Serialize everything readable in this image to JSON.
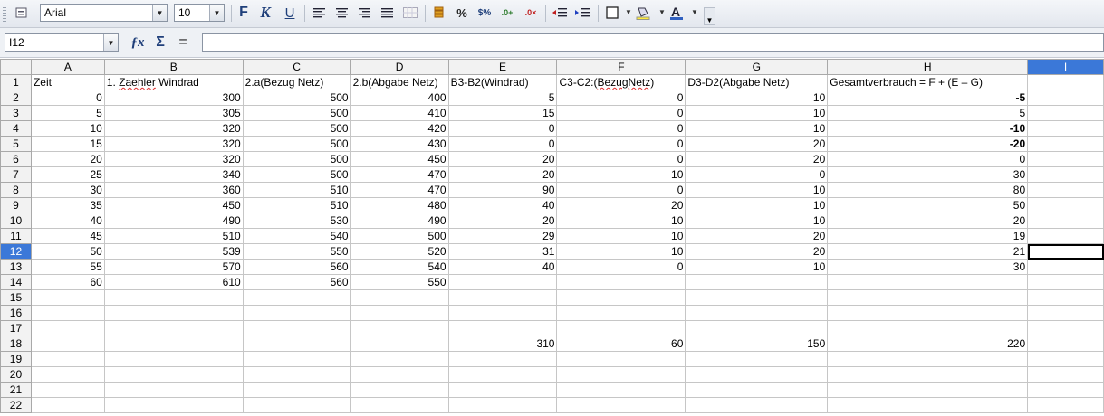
{
  "toolbar": {
    "font_name": "Arial",
    "font_size": "10",
    "bold_label": "F",
    "italic_label": "K",
    "underline_label": "U",
    "percent_label": "%"
  },
  "formula_bar": {
    "cell_ref": "I12",
    "formula": ""
  },
  "sheet": {
    "columns": [
      "A",
      "B",
      "C",
      "D",
      "E",
      "F",
      "G",
      "H",
      "I"
    ],
    "selected_column": "I",
    "selected_row": "12",
    "rows": [
      {
        "n": "1",
        "cells": [
          "Zeit",
          "1. Zaehler Windrad",
          "2.a(Bezug Netz)",
          "2.b(Abgabe Netz)",
          "B3-B2(Windrad)",
          "C3-C2:(BezugNetz)",
          "D3-D2(Abgabe Netz)",
          "Gesamtverbrauch = F + (E – G)",
          ""
        ]
      },
      {
        "n": "2",
        "cells": [
          "0",
          "300",
          "500",
          "400",
          "5",
          "0",
          "10",
          "-5",
          ""
        ]
      },
      {
        "n": "3",
        "cells": [
          "5",
          "305",
          "500",
          "410",
          "15",
          "0",
          "10",
          "5",
          ""
        ]
      },
      {
        "n": "4",
        "cells": [
          "10",
          "320",
          "500",
          "420",
          "0",
          "0",
          "10",
          "-10",
          ""
        ]
      },
      {
        "n": "5",
        "cells": [
          "15",
          "320",
          "500",
          "430",
          "0",
          "0",
          "20",
          "-20",
          ""
        ]
      },
      {
        "n": "6",
        "cells": [
          "20",
          "320",
          "500",
          "450",
          "20",
          "0",
          "20",
          "0",
          ""
        ]
      },
      {
        "n": "7",
        "cells": [
          "25",
          "340",
          "500",
          "470",
          "20",
          "10",
          "0",
          "30",
          ""
        ]
      },
      {
        "n": "8",
        "cells": [
          "30",
          "360",
          "510",
          "470",
          "90",
          "0",
          "10",
          "80",
          ""
        ]
      },
      {
        "n": "9",
        "cells": [
          "35",
          "450",
          "510",
          "480",
          "40",
          "20",
          "10",
          "50",
          ""
        ]
      },
      {
        "n": "10",
        "cells": [
          "40",
          "490",
          "530",
          "490",
          "20",
          "10",
          "10",
          "20",
          ""
        ]
      },
      {
        "n": "11",
        "cells": [
          "45",
          "510",
          "540",
          "500",
          "29",
          "10",
          "20",
          "19",
          ""
        ]
      },
      {
        "n": "12",
        "cells": [
          "50",
          "539",
          "550",
          "520",
          "31",
          "10",
          "20",
          "21",
          ""
        ]
      },
      {
        "n": "13",
        "cells": [
          "55",
          "570",
          "560",
          "540",
          "40",
          "0",
          "10",
          "30",
          ""
        ]
      },
      {
        "n": "14",
        "cells": [
          "60",
          "610",
          "560",
          "550",
          "",
          "",
          "",
          "",
          ""
        ]
      },
      {
        "n": "15",
        "cells": [
          "",
          "",
          "",
          "",
          "",
          "",
          "",
          "",
          ""
        ]
      },
      {
        "n": "16",
        "cells": [
          "",
          "",
          "",
          "",
          "",
          "",
          "",
          "",
          ""
        ]
      },
      {
        "n": "17",
        "cells": [
          "",
          "",
          "",
          "",
          "",
          "",
          "",
          "",
          ""
        ]
      },
      {
        "n": "18",
        "cells": [
          "",
          "",
          "",
          "",
          "310",
          "60",
          "150",
          "220",
          ""
        ]
      },
      {
        "n": "19",
        "cells": [
          "",
          "",
          "",
          "",
          "",
          "",
          "",
          "",
          ""
        ]
      },
      {
        "n": "20",
        "cells": [
          "",
          "",
          "",
          "",
          "",
          "",
          "",
          "",
          ""
        ]
      },
      {
        "n": "21",
        "cells": [
          "",
          "",
          "",
          "",
          "",
          "",
          "",
          "",
          ""
        ]
      },
      {
        "n": "22",
        "cells": [
          "",
          "",
          "",
          "",
          "",
          "",
          "",
          "",
          ""
        ]
      }
    ]
  }
}
